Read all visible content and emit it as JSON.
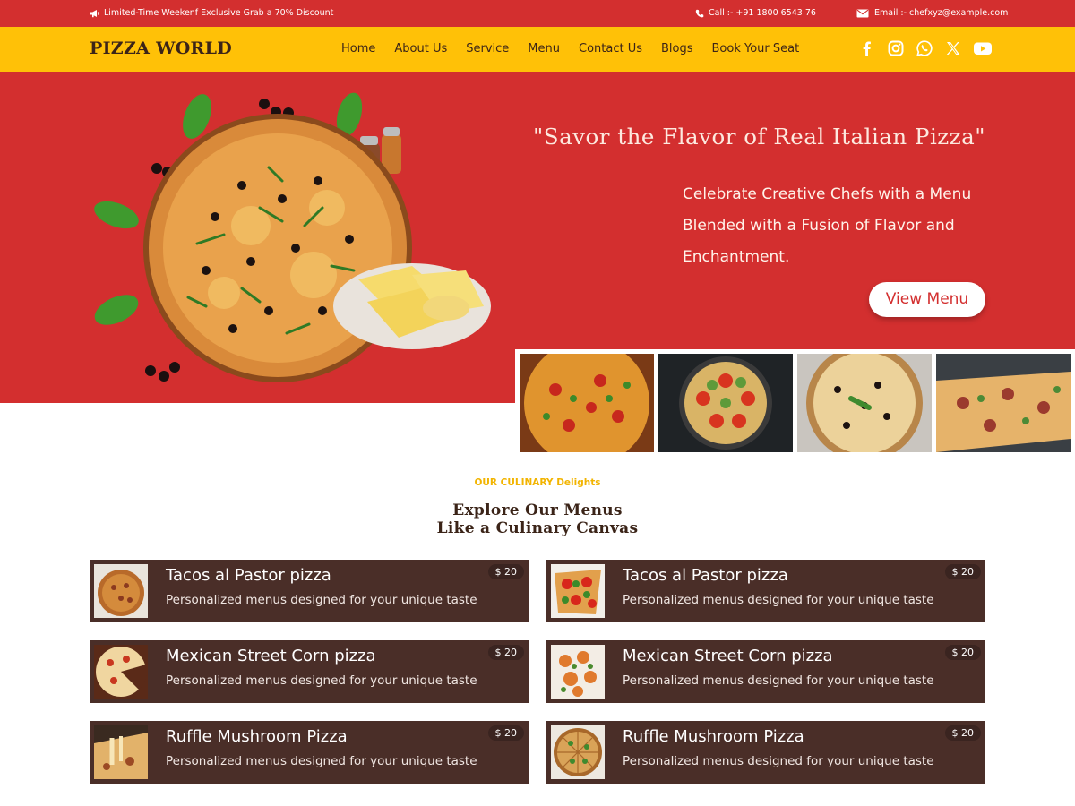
{
  "topbar": {
    "promo": "Limited-Time Weekenf Exclusive Grab a 70% Discount",
    "call": "Call :- +91 1800 6543 76",
    "email": "Email :- chefxyz@example.com",
    "icons": [
      "megaphone-icon",
      "phone-icon",
      "envelope-icon"
    ]
  },
  "nav": {
    "brand": "PIZZA WORLD",
    "items": [
      "Home",
      "About Us",
      "Service",
      "Menu",
      "Contact Us",
      "Blogs",
      "Book Your Seat"
    ],
    "social": [
      "facebook-icon",
      "instagram-icon",
      "whatsapp-icon",
      "x-icon",
      "youtube-icon"
    ]
  },
  "hero": {
    "title": "\"Savor the Flavor of Real Italian Pizza\"",
    "subtitle_lines": [
      "Celebrate Creative Chefs with a Menu",
      "Blended with a Fusion of Flavor and",
      "Enchantment."
    ],
    "button": "View Menu"
  },
  "section": {
    "eyebrow": "OUR CULINARY Delights",
    "title_lines": [
      "Explore Our Menus",
      "Like a Culinary Canvas"
    ]
  },
  "menu_items": [
    {
      "name": "Tacos al Pastor pizza",
      "desc": "Personalized menus designed for your unique taste",
      "price": "$ 20"
    },
    {
      "name": "Tacos al Pastor pizza",
      "desc": "Personalized menus designed for your unique taste",
      "price": "$ 20"
    },
    {
      "name": "Mexican Street Corn pizza",
      "desc": "Personalized menus designed for your unique taste",
      "price": "$ 20"
    },
    {
      "name": "Mexican Street Corn pizza",
      "desc": "Personalized menus designed for your unique taste",
      "price": "$ 20"
    },
    {
      "name": "Ruffle Mushroom Pizza",
      "desc": "Personalized menus designed for your unique taste",
      "price": "$ 20"
    },
    {
      "name": "Ruffle Mushroom Pizza",
      "desc": "Personalized menus designed for your unique taste",
      "price": "$ 20"
    }
  ],
  "colors": {
    "primary_red": "#d32f2f",
    "accent_yellow": "#ffc107",
    "card_brown": "#4a2e28",
    "brand_dark": "#3b2418",
    "eyebrow_gold": "#f2b400"
  }
}
